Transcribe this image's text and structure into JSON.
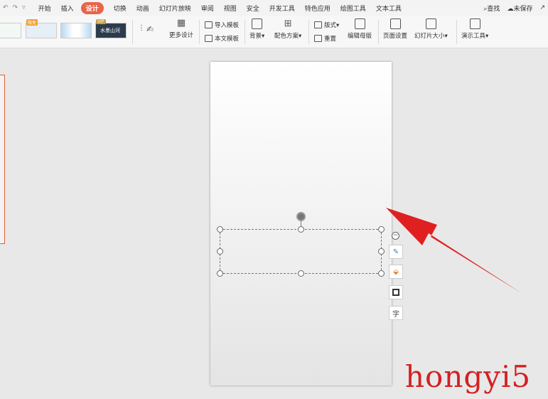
{
  "menubar": {
    "quick_access": [
      "↶",
      "↷",
      "▿"
    ],
    "tabs": [
      "开始",
      "插入",
      "设计",
      "切换",
      "动画",
      "幻灯片放映",
      "审阅",
      "视图",
      "安全",
      "开发工具",
      "特色应用",
      "绘图工具",
      "文本工具"
    ],
    "active_tab": "设计",
    "search_label": "查找",
    "unsaved_label": "未保存",
    "accent_color": "#e8654a"
  },
  "ribbon": {
    "free_badge": "限免",
    "vip_badge": "VIP",
    "thumb_text": "水墨山河",
    "more_design": "更多设计",
    "import_template": "导入模板",
    "body_template": "本文模板",
    "background": "背景",
    "color_scheme": "配色方案",
    "layout": "版式",
    "reset": "重置",
    "edit_master": "编辑母版",
    "page_setup": "页面设置",
    "slide_size": "幻灯片大小",
    "present_tools": "演示工具"
  },
  "float_toolbar": {
    "minus": "−",
    "text_icon_label": "字"
  },
  "watermark": "hongyi5",
  "colors": {
    "arrow": "#e02020",
    "selection_border": "#e06030"
  }
}
